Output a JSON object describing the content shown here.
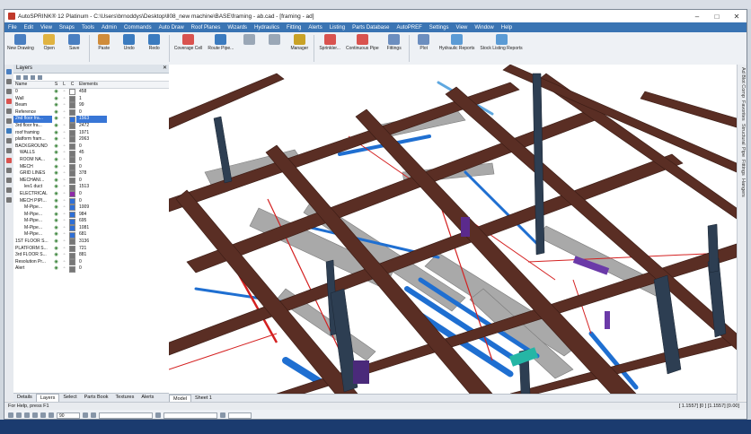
{
  "window": {
    "title": "AutoSPRINK® 12 Platinum - C:\\Users\\brnoddys\\Desktop\\ll08_new machine\\BASE\\framing - ab.cad - [framing - ad]",
    "controls": [
      "–",
      "□",
      "✕"
    ]
  },
  "menu": [
    "File",
    "Edit",
    "View",
    "Snaps",
    "Tools",
    "Admin",
    "Commands",
    "Auto Draw",
    "Roof Planes",
    "Wizards",
    "Hydraulics",
    "Fitting",
    "Alerts",
    "Listing",
    "Parts Database",
    "AutoPREF",
    "Settings",
    "View",
    "Window",
    "Help"
  ],
  "ribbon": [
    {
      "label": "New Drawing",
      "color": "#4a7fc1"
    },
    {
      "label": "Open",
      "color": "#e0b341"
    },
    {
      "label": "Save",
      "color": "#4a7fc1"
    },
    {
      "label": "Paste",
      "color": "#d08c3a"
    },
    {
      "label": "Undo",
      "color": "#3b7bbf"
    },
    {
      "label": "Redo",
      "color": "#3b7bbf"
    },
    {
      "label": "Coverage Cell",
      "color": "#d9534f"
    },
    {
      "label": "Route Pipe...",
      "color": "#3b7bbf"
    },
    {
      "label": "",
      "color": "#9aa7b6"
    },
    {
      "label": "",
      "color": "#9aa7b6"
    },
    {
      "label": "Manager",
      "color": "#c9a227"
    },
    {
      "label": "Sprinkler...",
      "color": "#d9534f"
    },
    {
      "label": "Continuous Pipe",
      "color": "#d9534f"
    },
    {
      "label": "Fittings",
      "color": "#6c8ebf"
    },
    {
      "label": "Plot",
      "color": "#6c8ebf"
    },
    {
      "label": "Hydraulic Reports",
      "color": "#5b9bd5"
    },
    {
      "label": "Stock Listing Reports",
      "color": "#5b9bd5"
    }
  ],
  "layers_panel": {
    "title": "Layers",
    "columns": {
      "name": "Name",
      "s": "S",
      "l": "L",
      "c": "C",
      "elements": "Elements"
    },
    "rows": [
      {
        "name": "0",
        "color": "#ffffff",
        "elements": "458",
        "indent": 0,
        "selected": false
      },
      {
        "name": "Wall",
        "color": "#777777",
        "elements": "1",
        "indent": 0,
        "selected": false
      },
      {
        "name": "Beam",
        "color": "#777777",
        "elements": "99",
        "indent": 0,
        "selected": false
      },
      {
        "name": "Reference",
        "color": "#777777",
        "elements": "0",
        "indent": 0,
        "selected": false
      },
      {
        "name": "2nd floor fra...",
        "color": "#2f6fd6",
        "elements": "1563",
        "indent": 0,
        "selected": true
      },
      {
        "name": "3rd floor fra...",
        "color": "#777777",
        "elements": "2472",
        "indent": 0,
        "selected": false
      },
      {
        "name": "roof framing",
        "color": "#777777",
        "elements": "1971",
        "indent": 0,
        "selected": false
      },
      {
        "name": "platform fram...",
        "color": "#777777",
        "elements": "2063",
        "indent": 0,
        "selected": false
      },
      {
        "name": "BACKGROUND",
        "color": "#777777",
        "elements": "0",
        "indent": 0,
        "selected": false
      },
      {
        "name": "WALLS",
        "color": "#777777",
        "elements": "45",
        "indent": 1,
        "selected": false
      },
      {
        "name": "ROOM NA...",
        "color": "#777777",
        "elements": "0",
        "indent": 1,
        "selected": false
      },
      {
        "name": "MECH",
        "color": "#777777",
        "elements": "0",
        "indent": 1,
        "selected": false
      },
      {
        "name": "GRID LINES",
        "color": "#777777",
        "elements": "378",
        "indent": 1,
        "selected": false
      },
      {
        "name": "MECHANI...",
        "color": "#777777",
        "elements": "0",
        "indent": 1,
        "selected": false
      },
      {
        "name": "lev1 duct",
        "color": "#777777",
        "elements": "1513",
        "indent": 2,
        "selected": false
      },
      {
        "name": "ELECTRICAL",
        "color": "#8e2aa8",
        "elements": "0",
        "indent": 1,
        "selected": false
      },
      {
        "name": "MECH PIPI...",
        "color": "#2f6fd6",
        "elements": "0",
        "indent": 1,
        "selected": false
      },
      {
        "name": "M-Pipe...",
        "color": "#2f6fd6",
        "elements": "1009",
        "indent": 2,
        "selected": false
      },
      {
        "name": "M-Pipe...",
        "color": "#2f6fd6",
        "elements": "984",
        "indent": 2,
        "selected": false
      },
      {
        "name": "M-Pipe...",
        "color": "#2f6fd6",
        "elements": "695",
        "indent": 2,
        "selected": false
      },
      {
        "name": "M-Pipe...",
        "color": "#2f6fd6",
        "elements": "1081",
        "indent": 2,
        "selected": false
      },
      {
        "name": "M-Pipe...",
        "color": "#2f6fd6",
        "elements": "681",
        "indent": 2,
        "selected": false
      },
      {
        "name": "1ST FLOOR S...",
        "color": "#777777",
        "elements": "3136",
        "indent": 0,
        "selected": false
      },
      {
        "name": "PLATFORM S...",
        "color": "#777777",
        "elements": "721",
        "indent": 0,
        "selected": false
      },
      {
        "name": "3rd FLOOR S...",
        "color": "#777777",
        "elements": "881",
        "indent": 0,
        "selected": false
      },
      {
        "name": "Resolution Pr...",
        "color": "#777777",
        "elements": "0",
        "indent": 0,
        "selected": false
      },
      {
        "name": "Alert",
        "color": "#777777",
        "elements": "0",
        "indent": 0,
        "selected": false
      }
    ],
    "tabs": [
      "Details",
      "Layers",
      "Select",
      "Parts Book",
      "Textures",
      "Alerts"
    ],
    "active_tab": "Layers"
  },
  "view_tabs": [
    "Model",
    "Sheet 1"
  ],
  "active_view_tab": "Model",
  "right_rail": [
    "Ad Blot Comp",
    "Favorites",
    "Structural",
    "Pipe",
    "Fittings",
    "Hangers"
  ],
  "status": {
    "left": "For Help, press F1",
    "right": "[ 1.1557] [0 ] [1.1557] [0.00]"
  },
  "bottom_fields": [
    "90",
    "",
    "",
    ""
  ]
}
